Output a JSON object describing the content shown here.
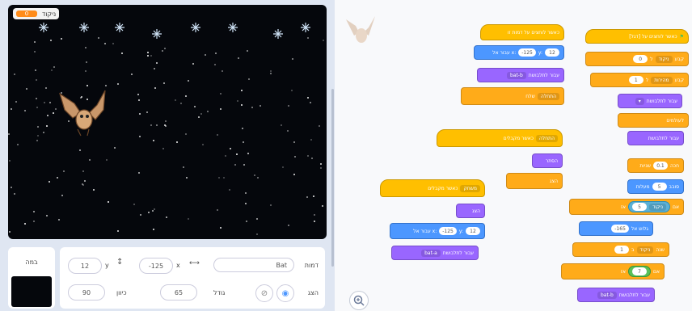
{
  "stage": {
    "variable_monitor": {
      "label": "ניקוד",
      "value": "0"
    }
  },
  "sprite_info": {
    "name_label": "דמות",
    "name_value": "Bat",
    "x_label": "x",
    "x_value": "-125",
    "y_label": "y",
    "y_value": "12",
    "show_label": "הצג",
    "size_label": "גודל",
    "size_value": "65",
    "direction_label": "כיוון",
    "direction_value": "90"
  },
  "stage_panel": {
    "label": "במה"
  },
  "scripts": {
    "s1": {
      "hat": "כאשר לוחצים על [דגל]",
      "b1_label": "קבע",
      "b1_var": "ניקוד",
      "b1_to": "ל",
      "b1_value": "0",
      "b2_label": "קבע",
      "b2_var": "מהירות",
      "b2_to": "ל",
      "b2_value": "1",
      "b3": "עבור לתלבושת",
      "b4": "לעולמים",
      "b5": "חכה",
      "b5_value": "0.1",
      "b5_unit": "שניות",
      "b6_label": "סובב",
      "b6_value": "5",
      "b6_unit": "מעלות",
      "b7": "אם",
      "b7_var": "ניקוד",
      "b7_value": "5",
      "b7_then": "אז",
      "b8": "גלוש אל",
      "b8_value": "-165",
      "b9_label": "שנה",
      "b9_var": "ניקוד",
      "b9_by": "ב",
      "b9_value": "1",
      "b10": "אם",
      "b10_value": "7",
      "b10_then": "אז",
      "b11": "עבור לתלבושת",
      "b11_value": "bat-b"
    },
    "s2": {
      "hat": "כאשר לוחצים על דמות זו",
      "b1": "עבור אל x:",
      "b1_x": "-125",
      "b1_y_label": "y:",
      "b1_y": "12",
      "b2": "עבור לתלבושת",
      "b2_value": "bat-b",
      "b3": "שלח",
      "b3_value": "התחלה"
    },
    "s3": {
      "hat": "כאשר מקבלים",
      "hat_value": "התחלה",
      "b1": "הסתר",
      "b2": "הצג"
    },
    "s4": {
      "hat": "כאשר מקבלים",
      "hat_value": "משחק",
      "b1": "הצג",
      "b2": "עבור אל x:",
      "b2_x": "-125",
      "b2_y_label": "y:",
      "b2_y": "12",
      "b3": "עבור לתלבושת",
      "b3_value": "bat-a"
    }
  }
}
